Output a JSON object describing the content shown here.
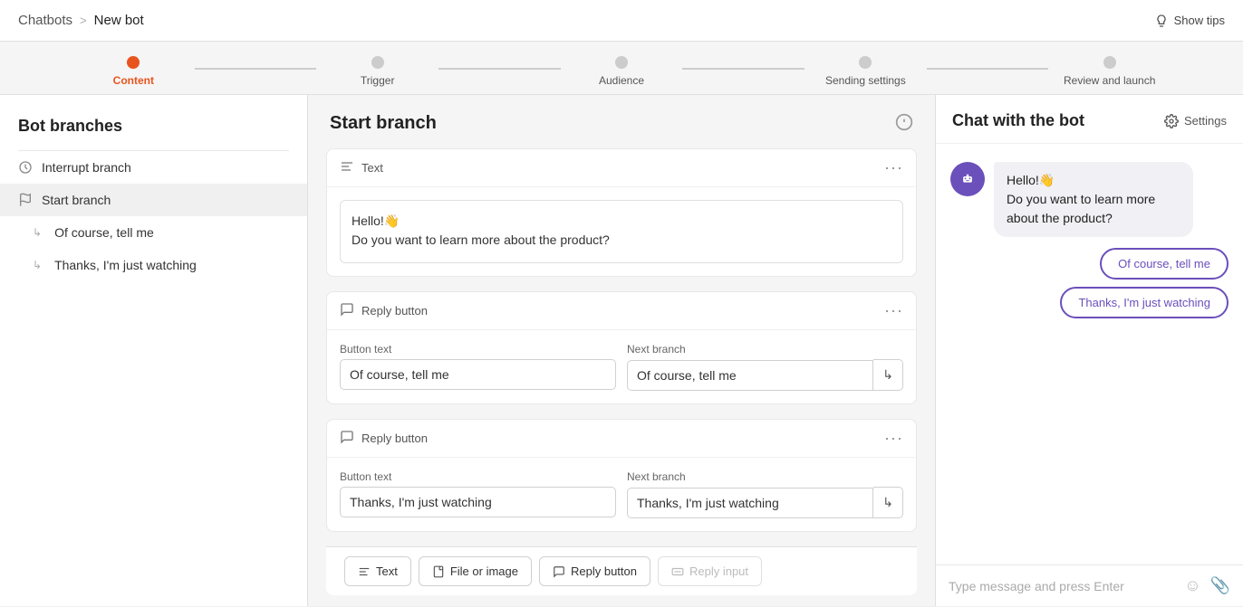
{
  "topbar": {
    "chatbots_label": "Chatbots",
    "separator": ">",
    "current_page": "New bot",
    "show_tips_label": "Show tips"
  },
  "stepper": {
    "steps": [
      {
        "label": "Content",
        "active": true
      },
      {
        "label": "Trigger",
        "active": false
      },
      {
        "label": "Audience",
        "active": false
      },
      {
        "label": "Sending settings",
        "active": false
      },
      {
        "label": "Review and launch",
        "active": false
      }
    ]
  },
  "sidebar": {
    "title": "Bot branches",
    "items": [
      {
        "label": "Interrupt branch",
        "active": false,
        "type": "root"
      },
      {
        "label": "Start branch",
        "active": true,
        "type": "root"
      },
      {
        "label": "Of course, tell me",
        "active": false,
        "type": "sub"
      },
      {
        "label": "Thanks, I'm just watching",
        "active": false,
        "type": "sub"
      }
    ]
  },
  "center": {
    "branch_title": "Start branch",
    "blocks": [
      {
        "type": "text",
        "header_label": "Text",
        "content": "Hello!👋\nDo you want to learn more about the product?"
      },
      {
        "type": "reply_button",
        "header_label": "Reply button",
        "button_text_label": "Button text",
        "button_text_value": "Of course, tell me",
        "next_branch_label": "Next branch",
        "next_branch_value": "Of course, tell me"
      },
      {
        "type": "reply_button",
        "header_label": "Reply button",
        "button_text_label": "Button text",
        "button_text_value": "Thanks, I'm just watching",
        "next_branch_label": "Next branch",
        "next_branch_value": "Thanks, I'm just watching"
      }
    ],
    "toolbar": {
      "text_label": "Text",
      "file_or_image_label": "File or image",
      "reply_button_label": "Reply button",
      "reply_input_label": "Reply input"
    }
  },
  "chat": {
    "title": "Chat with the bot",
    "settings_label": "Settings",
    "bot_message_line1": "Hello!👋",
    "bot_message_line2": "Do you want to learn more about the product?",
    "reply_buttons": [
      {
        "label": "Of course, tell me"
      },
      {
        "label": "Thanks, I'm just watching"
      }
    ],
    "input_placeholder": "Type message and press Enter"
  }
}
